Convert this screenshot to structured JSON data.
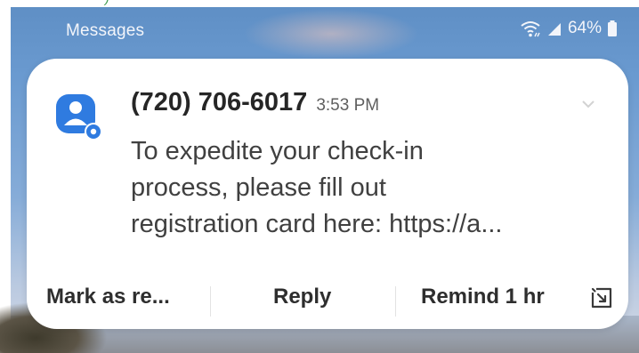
{
  "status_bar": {
    "app_name": "Messages",
    "battery": "64%"
  },
  "notification": {
    "sender": "(720) 706-6017",
    "time": "3:53 PM",
    "message_lines": [
      "To expedite your check-in",
      "process, please fill out",
      "registration card here: https://a..."
    ],
    "actions": {
      "mark_read": "Mark as re...",
      "reply": "Reply",
      "remind": "Remind 1 hr"
    }
  },
  "colors": {
    "app_icon": "#2f7be0",
    "card_background": "#ffffff",
    "text_primary": "#262626"
  },
  "icons": [
    "wifi-icon",
    "signal-icon",
    "battery-icon",
    "contact-icon",
    "chevron-down-icon",
    "snooze-icon"
  ]
}
